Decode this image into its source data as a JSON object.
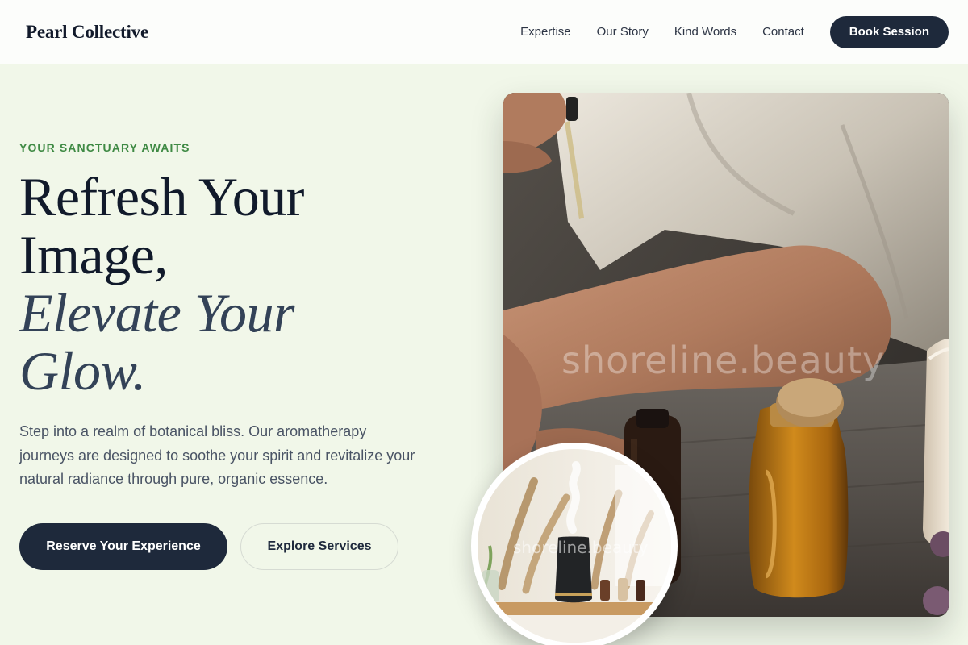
{
  "header": {
    "brand": "Pearl Collective",
    "nav": [
      "Expertise",
      "Our Story",
      "Kind Words",
      "Contact"
    ],
    "cta": "Book Session"
  },
  "hero": {
    "eyebrow": "YOUR SANCTUARY AWAITS",
    "headline_lines": [
      "Refresh Your",
      "Image,"
    ],
    "headline_italic_lines": [
      "Elevate Your",
      "Glow."
    ],
    "lead": "Step into a realm of botanical bliss. Our aromatherapy journeys are designed to soothe your spirit and revitalize your natural radiance through pure, organic essence.",
    "primary_button": "Reserve Your Experience",
    "secondary_button": "Explore Services"
  },
  "media": {
    "main_image_watermark": "shoreline.beauty",
    "inset_image_watermark": "shoreline.beauty"
  },
  "colors": {
    "background": "#f1f7e9",
    "accent_green": "#3f8a44",
    "navy": "#1e293b"
  }
}
